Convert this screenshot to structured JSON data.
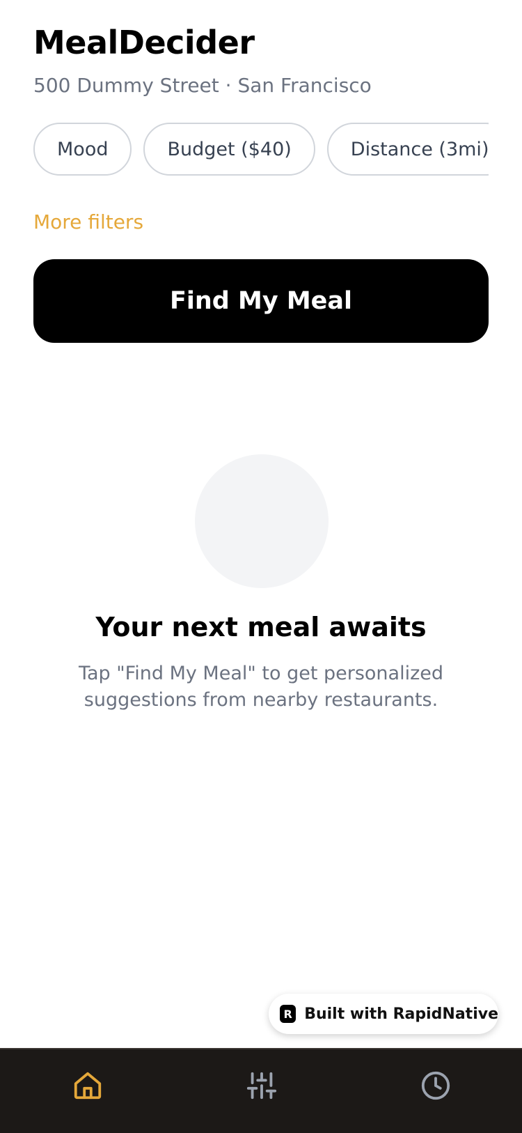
{
  "header": {
    "title": "MealDecider",
    "address": "500 Dummy Street · San Francisco"
  },
  "filters": {
    "chips": [
      "Mood",
      "Budget ($40)",
      "Distance (3mi)"
    ],
    "more_label": "More filters"
  },
  "cta": {
    "label": "Find My Meal"
  },
  "empty_state": {
    "title": "Your next meal awaits",
    "description": "Tap \"Find My Meal\" to get personalized suggestions from nearby restaurants."
  },
  "badge": {
    "label": "Built with RapidNative"
  },
  "tabbar": {
    "items": [
      {
        "icon": "home-icon",
        "active": true
      },
      {
        "icon": "sliders-icon",
        "active": false
      },
      {
        "icon": "clock-icon",
        "active": false
      }
    ]
  },
  "colors": {
    "accent": "#E5A83A",
    "background": "#FFFFFF",
    "primary_button": "#000000",
    "tabbar_bg": "#1C1917",
    "muted_text": "#6B7280",
    "inactive_icon": "#9CA3AF"
  }
}
